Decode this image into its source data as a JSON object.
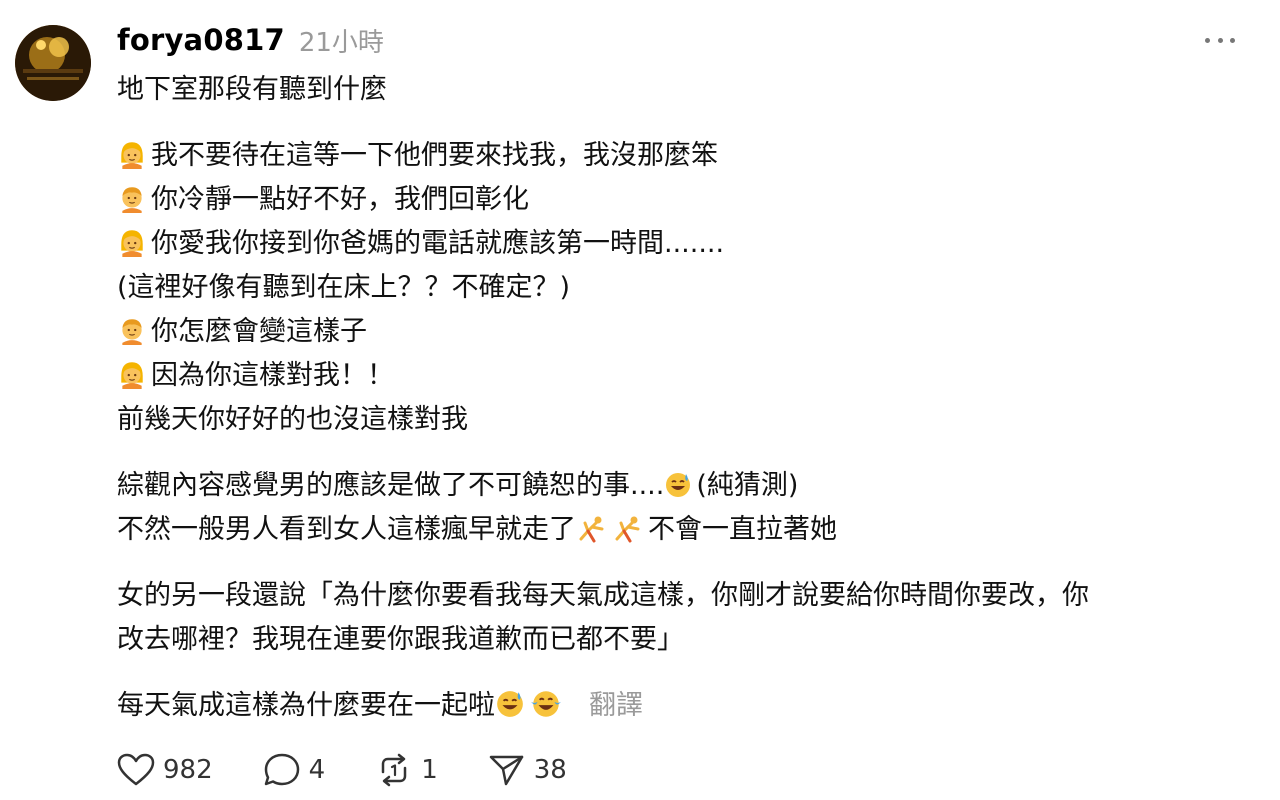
{
  "post": {
    "username": "forya0817",
    "timestamp": "21小時",
    "lines": [
      "地下室那段有聽到什麼"
    ],
    "dialog": [
      {
        "speaker": "woman",
        "text": "我不要待在這等一下他們要來找我，我沒那麼笨"
      },
      {
        "speaker": "man",
        "text": "你冷靜一點好不好，我們回彰化"
      },
      {
        "speaker": "woman",
        "text": "你愛我你接到你爸媽的電話就應該第一時間......."
      },
      {
        "speaker": "",
        "text": "(這裡好像有聽到在床上？？不確定？)"
      },
      {
        "speaker": "man",
        "text": "你怎麼會變這樣子"
      },
      {
        "speaker": "woman",
        "text": "因為你這樣對我！！"
      },
      {
        "speaker": "",
        "text": "前幾天你好好的也沒這樣對我"
      }
    ],
    "para2_line1_a": "綜觀內容感覺男的應該是做了不可饒恕的事....",
    "para2_line1_b": "(純猜測)",
    "para2_line2_a": "不然一般男人看到女人這樣瘋早就走了",
    "para2_line2_b": "不會一直拉著她",
    "para3_line1": "女的另一段還說「為什麼你要看我每天氣成這樣，你剛才說要給你時間你要改，你",
    "para3_line2": "改去哪裡？我現在連要你跟我道歉而已都不要」",
    "para4": "每天氣成這樣為什麼要在一起啦",
    "translate_label": "翻譯"
  },
  "actions": {
    "likes": "982",
    "comments": "4",
    "reposts": "1",
    "shares": "38"
  },
  "icons": {
    "woman": "woman-emoji-icon",
    "man": "man-emoji-icon",
    "sweat_smile": "sweat-smile-emoji-icon",
    "cartwheel": "cartwheel-emoji-icon",
    "tears_of_joy": "tears-of-joy-emoji-icon"
  },
  "colors": {
    "muted": "#9a9a9a",
    "text": "#111111"
  }
}
